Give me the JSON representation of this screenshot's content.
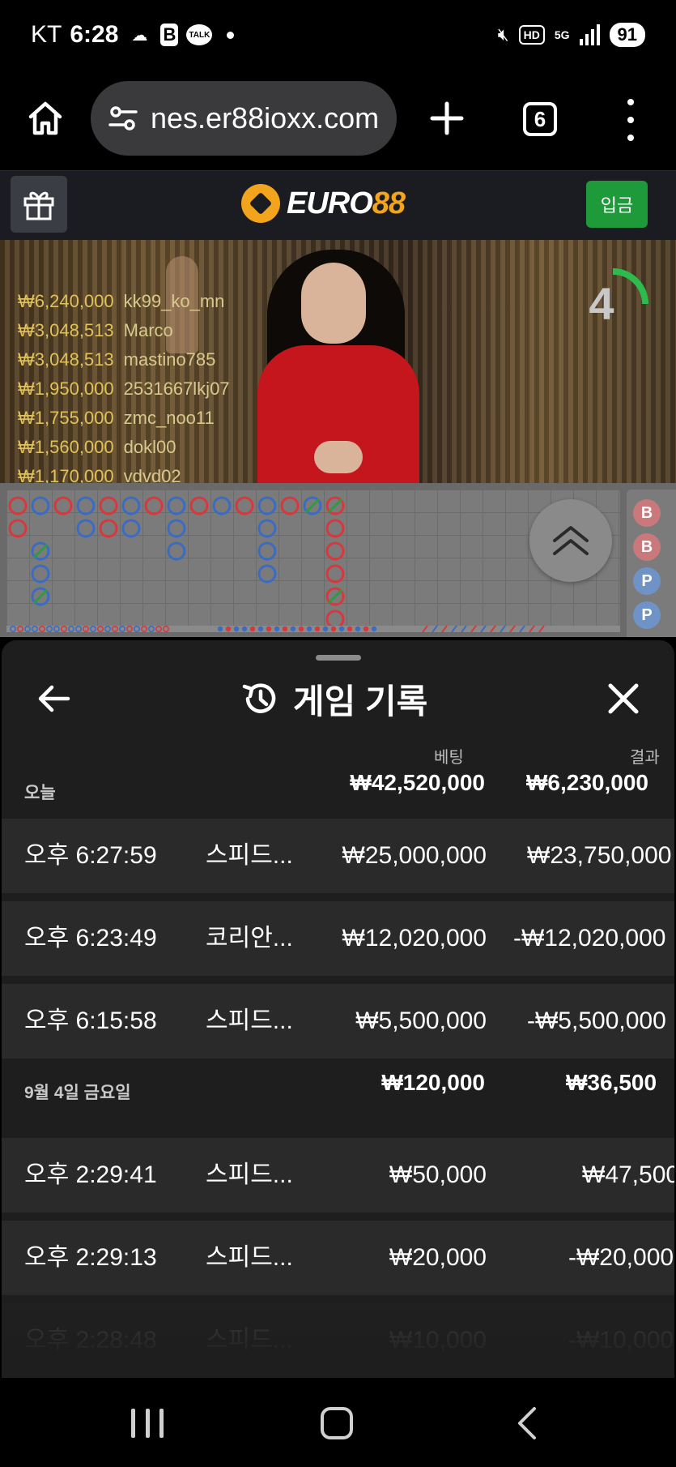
{
  "status_bar": {
    "carrier": "KT",
    "time": "6:28",
    "talk_label": "TALK",
    "b_label": "B",
    "hd_label": "HD",
    "net_label": "5G",
    "battery": "91"
  },
  "browser": {
    "url": "nes.er88ioxx.com",
    "tab_count": "6"
  },
  "site": {
    "logo_text": "EURO",
    "logo_num": "88",
    "deposit_label": "입금"
  },
  "video": {
    "timer": "4",
    "winners": [
      {
        "amount": "₩6,240,000",
        "name": "kk99_ko_mn"
      },
      {
        "amount": "₩3,048,513",
        "name": "Marco"
      },
      {
        "amount": "₩3,048,513",
        "name": "mastino785"
      },
      {
        "amount": "₩1,950,000",
        "name": "2531667lkj07"
      },
      {
        "amount": "₩1,755,000",
        "name": "zmc_noo11"
      },
      {
        "amount": "₩1,560,000",
        "name": "dokl00"
      },
      {
        "amount": "₩1,170,000",
        "name": "vdvd02"
      }
    ]
  },
  "roadmap": {
    "side_beads": [
      "B",
      "B",
      "P",
      "P"
    ]
  },
  "history": {
    "title": "게임 기록",
    "col_bet": "베팅",
    "col_result": "결과",
    "groups": [
      {
        "label": "오늘",
        "bet_total": "₩42,520,000",
        "result_total": "₩6,230,000",
        "rows": [
          {
            "time": "오후 6:27:59",
            "game": "스피드...",
            "bet": "₩25,000,000",
            "result": "₩23,750,000"
          },
          {
            "time": "오후 6:23:49",
            "game": "코리안...",
            "bet": "₩12,020,000",
            "result": "-₩12,020,000"
          },
          {
            "time": "오후 6:15:58",
            "game": "스피드...",
            "bet": "₩5,500,000",
            "result": "-₩5,500,000"
          }
        ]
      },
      {
        "label": "9월 4일 금요일",
        "bet_total": "₩120,000",
        "result_total": "₩36,500",
        "rows": [
          {
            "time": "오후 2:29:41",
            "game": "스피드...",
            "bet": "₩50,000",
            "result": "₩47,500"
          },
          {
            "time": "오후 2:29:13",
            "game": "스피드...",
            "bet": "₩20,000",
            "result": "-₩20,000"
          },
          {
            "time": "오후 2:28:48",
            "game": "스피드...",
            "bet": "₩10,000",
            "result": "-₩10,000"
          }
        ]
      }
    ]
  }
}
